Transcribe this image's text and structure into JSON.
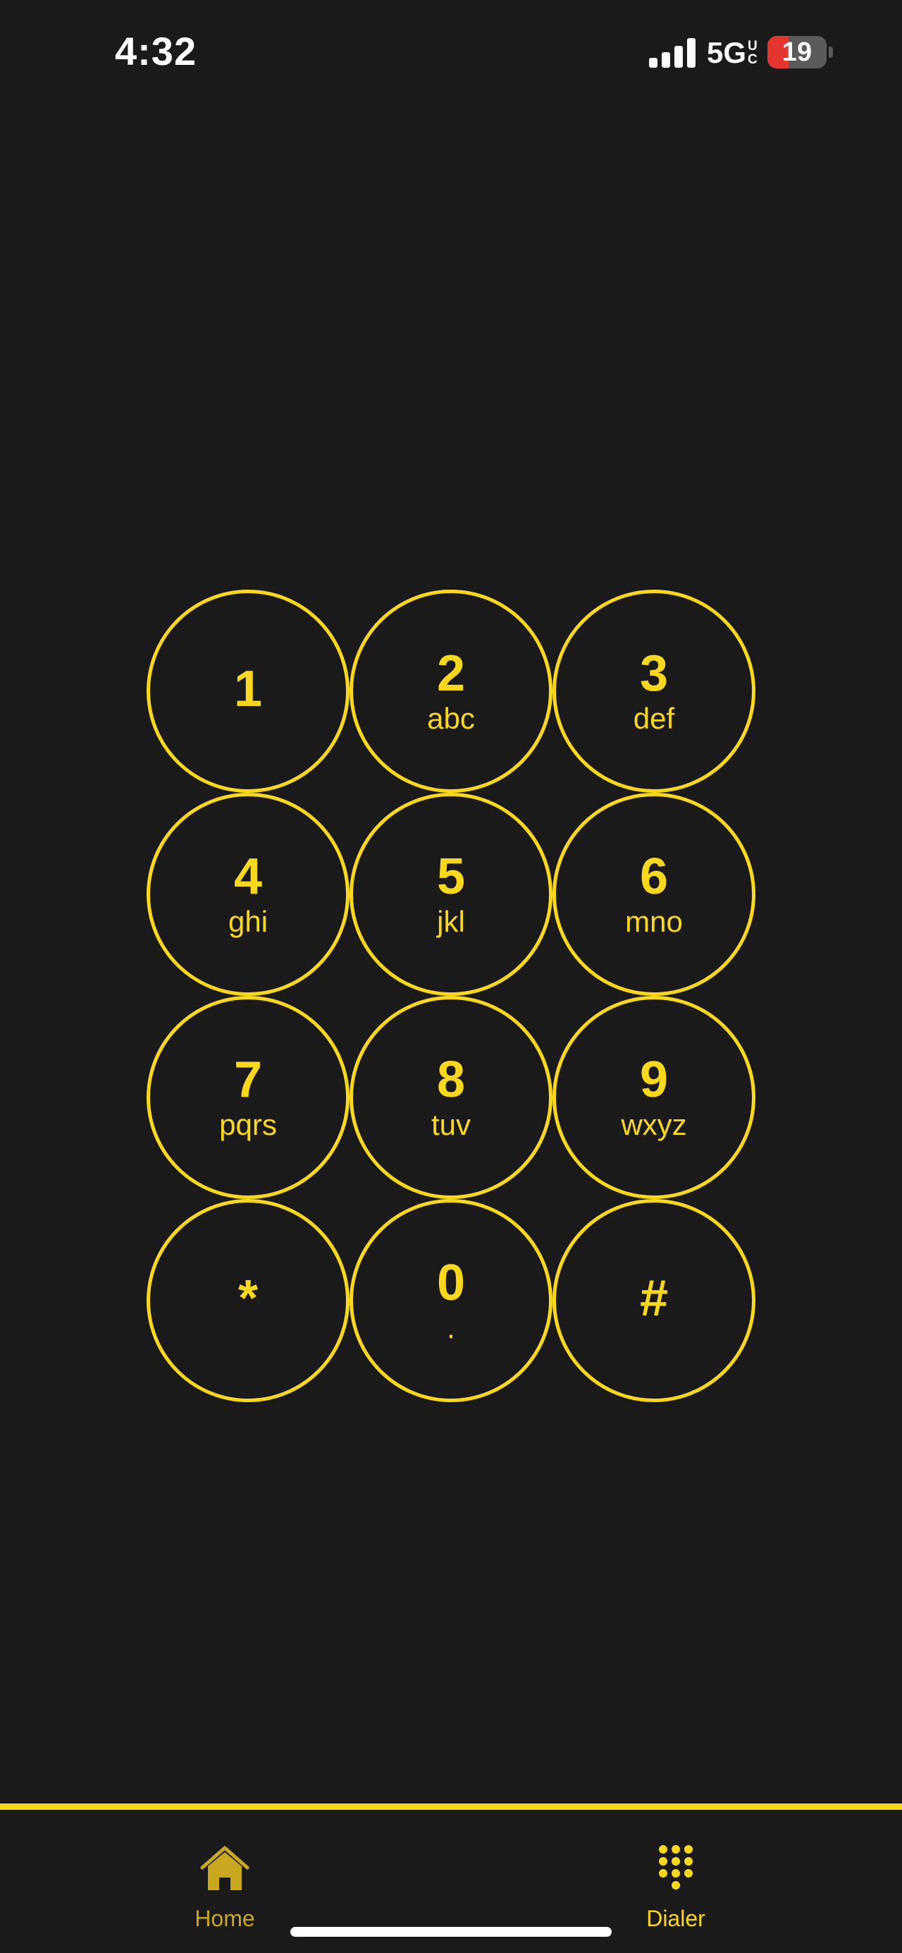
{
  "status_bar": {
    "time": "4:32",
    "network": "5G",
    "network_suffix_top": "U",
    "network_suffix_bottom": "C",
    "battery_level": "19",
    "battery_fraction": 0.19
  },
  "keypad": {
    "keys": [
      {
        "digit": "1",
        "letters": ""
      },
      {
        "digit": "2",
        "letters": "abc"
      },
      {
        "digit": "3",
        "letters": "def"
      },
      {
        "digit": "4",
        "letters": "ghi"
      },
      {
        "digit": "5",
        "letters": "jkl"
      },
      {
        "digit": "6",
        "letters": "mno"
      },
      {
        "digit": "7",
        "letters": "pqrs"
      },
      {
        "digit": "8",
        "letters": "tuv"
      },
      {
        "digit": "9",
        "letters": "wxyz"
      },
      {
        "digit": "*",
        "letters": ""
      },
      {
        "digit": "0",
        "letters": "."
      },
      {
        "digit": "#",
        "letters": ""
      }
    ]
  },
  "tab_bar": {
    "home_label": "Home",
    "home_icon": "house-icon",
    "dialer_label": "Dialer",
    "dialer_icon": "keypad-icon",
    "active_tab": "Dialer"
  },
  "colors": {
    "background": "#1a1a1a",
    "accent": "#fcd81c",
    "inactive_tab": "#c9a820",
    "battery_low": "#e5352f"
  }
}
